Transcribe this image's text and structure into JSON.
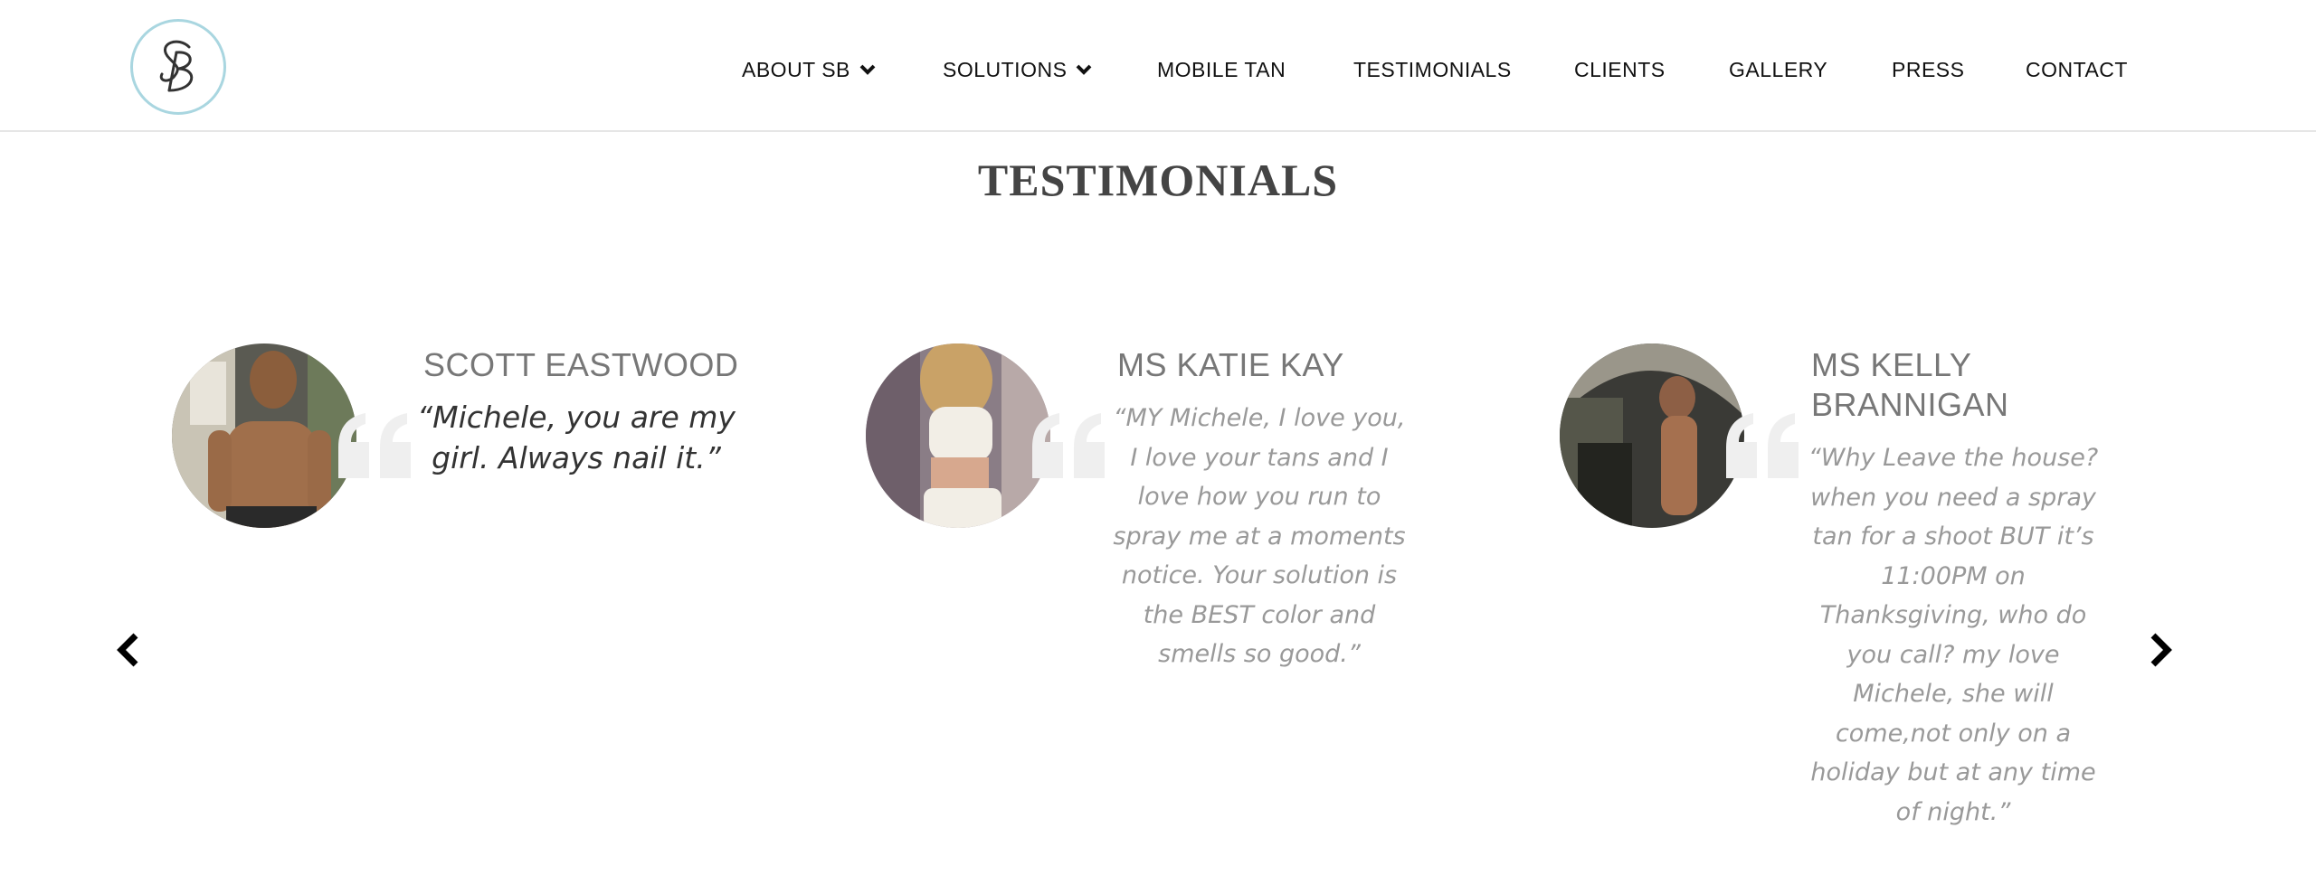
{
  "nav": {
    "items": [
      {
        "label": "ABOUT SB",
        "has_dropdown": true
      },
      {
        "label": "SOLUTIONS",
        "has_dropdown": true
      },
      {
        "label": "MOBILE TAN",
        "has_dropdown": false
      },
      {
        "label": "TESTIMONIALS",
        "has_dropdown": false
      },
      {
        "label": "CLIENTS",
        "has_dropdown": false
      },
      {
        "label": "GALLERY",
        "has_dropdown": false
      },
      {
        "label": "PRESS",
        "has_dropdown": false
      },
      {
        "label": "CONTACT",
        "has_dropdown": false
      }
    ]
  },
  "logo": {
    "text": "SB",
    "border_color": "#a9d6e0"
  },
  "section": {
    "title": "TESTIMONIALS"
  },
  "testimonials": [
    {
      "name": "SCOTT EASTWOOD",
      "quote": "“Michele, you are my girl.  Always nail it.”"
    },
    {
      "name": "MS KATIE KAY",
      "quote": "“MY Michele, I love you, I love your tans and I love how you run to spray me at a moments notice.  Your solution is the BEST color and smells so good.”"
    },
    {
      "name": "MS KELLY BRANNIGAN",
      "quote": "“Why Leave the house?  when you need a spray tan for a shoot BUT it’s 11:00PM on Thanksgiving, who do you call?  my love Michele,  she will come,not only on a holiday but at any time of night.”"
    }
  ],
  "icons": {
    "prev": "chevron-left-icon",
    "next": "chevron-right-icon",
    "quote": "quote-mark-icon",
    "caret": "chevron-down-icon"
  },
  "colors": {
    "heading": "#444444",
    "name": "#777777",
    "quote_text": "#999999",
    "quote_mark": "#eeeeee"
  }
}
